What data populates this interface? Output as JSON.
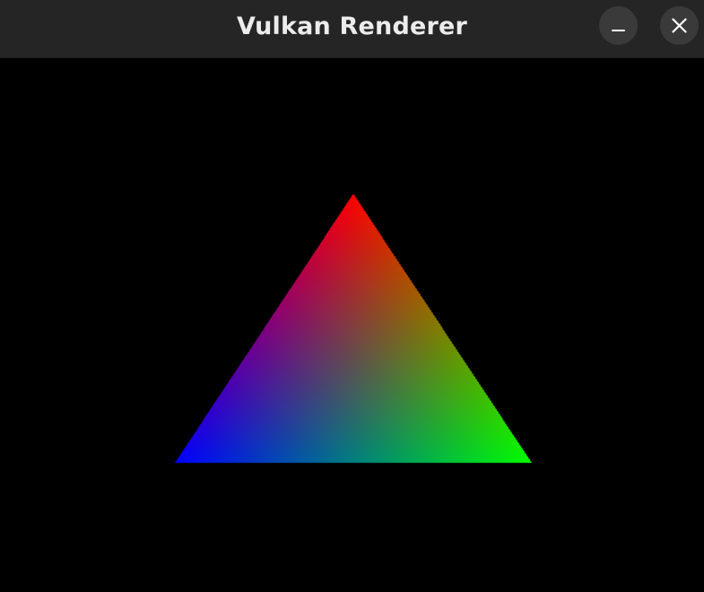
{
  "window": {
    "title": "Vulkan Renderer",
    "titlebar_color": "#252525",
    "button_color": "#3a3a3a",
    "icon_color": "#ffffff"
  },
  "buttons": {
    "minimize_icon": "minimize-icon",
    "close_icon": "close-icon"
  },
  "scene": {
    "clear_color": "#000000",
    "vertex_colors": [
      "#ff0000",
      "#00ff00",
      "#0000ff"
    ]
  }
}
